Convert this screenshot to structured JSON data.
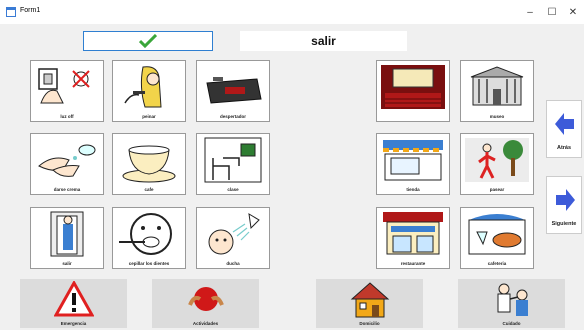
{
  "window": {
    "title": "Form1",
    "minimize": "–",
    "maximize": "☐",
    "close": "✕"
  },
  "top": {
    "confirm_icon": "checkmark-icon",
    "command_text": "salir"
  },
  "left_grid": [
    {
      "label": "luz off",
      "icon": "light-switch-icon"
    },
    {
      "label": "peinar",
      "icon": "comb-hair-icon"
    },
    {
      "label": "despertador",
      "icon": "alarm-clock-icon"
    },
    {
      "label": "darse crema",
      "icon": "cream-hands-icon"
    },
    {
      "label": "cafe",
      "icon": "coffee-cup-icon"
    },
    {
      "label": "clase",
      "icon": "classroom-icon"
    },
    {
      "label": "salir",
      "icon": "door-exit-icon"
    },
    {
      "label": "cepillar los dientes",
      "icon": "brush-teeth-icon"
    },
    {
      "label": "ducha",
      "icon": "shower-icon"
    }
  ],
  "right_grid": [
    {
      "label": "",
      "icon": "cinema-icon"
    },
    {
      "label": "museo",
      "icon": "museum-icon"
    },
    {
      "label": "tienda",
      "icon": "shop-icon"
    },
    {
      "label": "pasear",
      "icon": "walk-icon"
    },
    {
      "label": "restaurante",
      "icon": "restaurant-icon"
    },
    {
      "label": "cafeteria",
      "icon": "cafeteria-icon"
    }
  ],
  "nav": {
    "back": "Atrás",
    "next": "Siguiente"
  },
  "categories": [
    {
      "label": "Emergencia",
      "icon": "warning-icon"
    },
    {
      "label": "Actividades",
      "icon": "activities-icon"
    },
    {
      "label": "Domicilio",
      "icon": "house-icon"
    },
    {
      "label": "Cuidado",
      "icon": "care-icon"
    }
  ],
  "colors": {
    "accent": "#2f7fd1",
    "arrow": "#3d5bd9",
    "check": "#3aa63a",
    "emergency": "#e02020"
  }
}
